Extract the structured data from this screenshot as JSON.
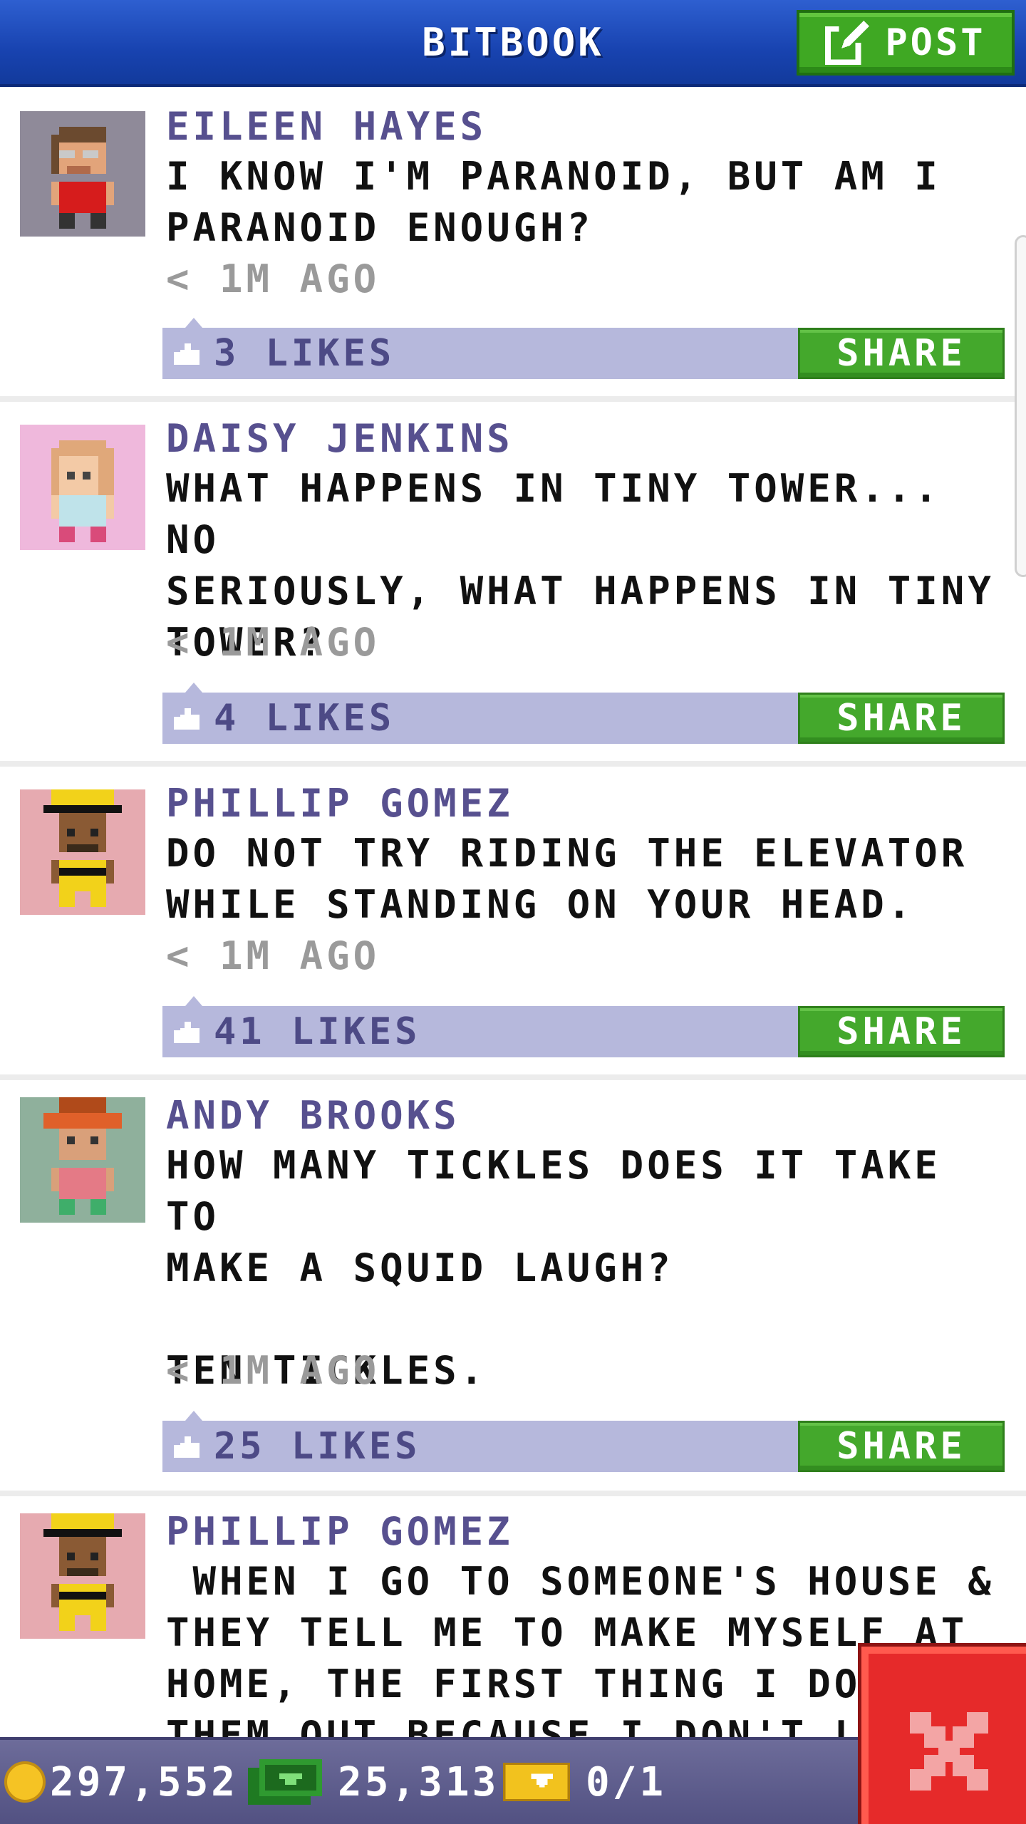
{
  "header": {
    "title": "BITBOOK",
    "post_label": "POST",
    "post_icon": "edit-icon"
  },
  "posts": [
    {
      "author": "EILEEN HAYES",
      "message": "I KNOW I'M PARANOID, BUT AM I\nPARANOID ENOUGH?",
      "time": "< 1M AGO",
      "likes": "3 LIKES",
      "share_label": "SHARE",
      "avatar_bg": "#8f8a99"
    },
    {
      "author": "DAISY JENKINS",
      "message": "WHAT HAPPENS IN TINY TOWER... NO\nSERIOUSLY, WHAT HAPPENS IN TINY\nTOWER?",
      "time": "< 1M AGO",
      "likes": "4 LIKES",
      "share_label": "SHARE",
      "avatar_bg": "#efb8dc"
    },
    {
      "author": "PHILLIP GOMEZ",
      "message": "DO NOT TRY RIDING THE ELEVATOR\nWHILE STANDING ON YOUR HEAD.",
      "time": "< 1M AGO",
      "likes": "41 LIKES",
      "share_label": "SHARE",
      "avatar_bg": "#e6aab0"
    },
    {
      "author": "ANDY BROOKS",
      "message": "HOW MANY TICKLES DOES IT TAKE TO\nMAKE A SQUID LAUGH?\n\nTEN TICKLES.",
      "time": "< 1M AGO",
      "likes": "25 LIKES",
      "share_label": "SHARE",
      "avatar_bg": "#8fb09c"
    },
    {
      "author": "PHILLIP GOMEZ",
      "message": " WHEN I GO TO SOMEONE'S HOUSE &\nTHEY TELL ME TO MAKE MYSELF AT\nHOME, THE FIRST THING I DO IS T\nTHEM OUT BECAUSE I DON'T LIKE",
      "time": "",
      "likes": "",
      "share_label": "",
      "avatar_bg": "#e6aab0"
    }
  ],
  "status": {
    "coins": "297,552",
    "bux": "25,313",
    "tickets": "0/1"
  },
  "colors": {
    "header_blue": "#1843b0",
    "author_purple": "#57508f",
    "likes_bar": "#b6b8dc",
    "share_green": "#44a82c",
    "close_red": "#e62a2a"
  }
}
